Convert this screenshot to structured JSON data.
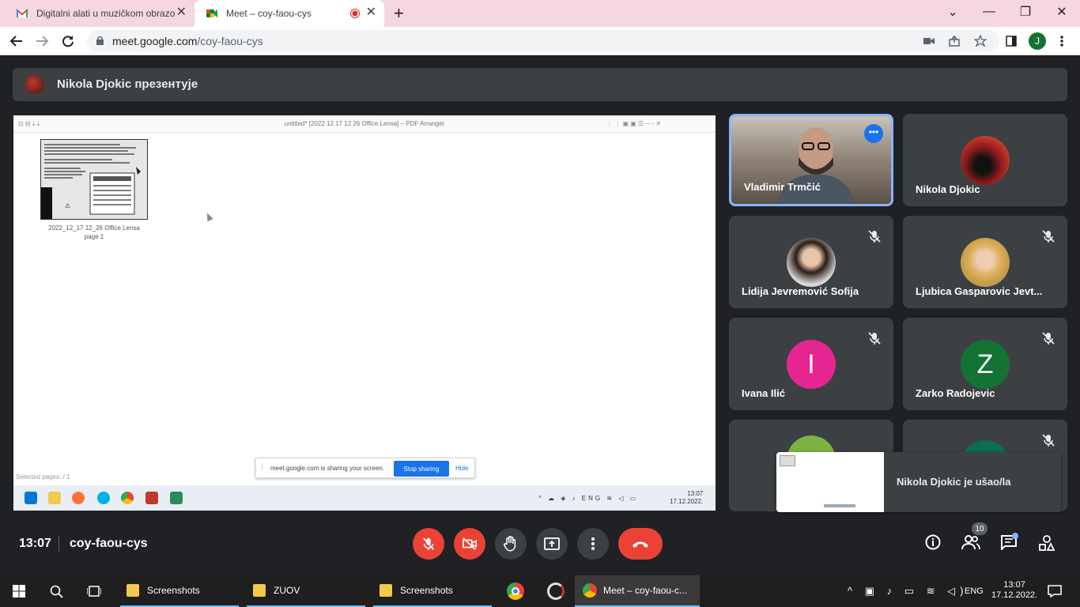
{
  "browser": {
    "tabs": [
      {
        "title": "Digitalni alati u muzičkom obrazo",
        "close": "✕"
      },
      {
        "title": "Meet – coy-faou-cys",
        "close": "✕"
      }
    ],
    "new_tab": "+",
    "url_host": "meet.google.com",
    "url_path": "/coy-faou-cys",
    "profile_initial": "J",
    "window_controls": {
      "dropdown": "⌄",
      "minimize": "—",
      "restore": "❐",
      "close": "✕"
    }
  },
  "presenter_bar": {
    "text": "Nikola Djokic презентује"
  },
  "shared_screen": {
    "app_title": "untitled* [2022 12 17 12 26 Office Lensa] – PDF Arranger",
    "thumb_label_line1": "2022_12_17 12_26 Office Lensa",
    "thumb_label_line2": "page 1",
    "selected_pages": "Selected pages: / 1",
    "share_notice": "meet.google.com is sharing your screen.",
    "stop_sharing": "Stop sharing",
    "hide": "Hide",
    "inner_lang": "ENG",
    "inner_time": "13:07",
    "inner_date": "17.12.2022."
  },
  "participants": [
    {
      "name": "Vladimir Trmčić",
      "muted": false
    },
    {
      "name": "Nikola Djokic",
      "muted": false
    },
    {
      "name": "Lidija Jevremović Sofija",
      "muted": true
    },
    {
      "name": "Ljubica Gasparovic Jevt...",
      "muted": true
    },
    {
      "name": "Ivana Ilić",
      "initial": "I",
      "color": "#e52592",
      "muted": true
    },
    {
      "name": "Zarko Radojevic",
      "initial": "Z",
      "color": "#137333",
      "muted": true
    }
  ],
  "toast": {
    "text": "Nikola Djokic je ušao/la"
  },
  "meeting": {
    "time": "13:07",
    "code": "coy-faou-cys",
    "people_count": "10"
  },
  "taskbar": {
    "items": [
      "Screenshots",
      "ZUOV",
      "Screenshots",
      "Meet – coy-faou-c..."
    ],
    "lang": "ENG",
    "time": "13:07",
    "date": "17.12.2022."
  },
  "colors": {
    "accent": "#1a73e8",
    "danger": "#ea4335",
    "tab_bg": "#f6d6e2"
  }
}
